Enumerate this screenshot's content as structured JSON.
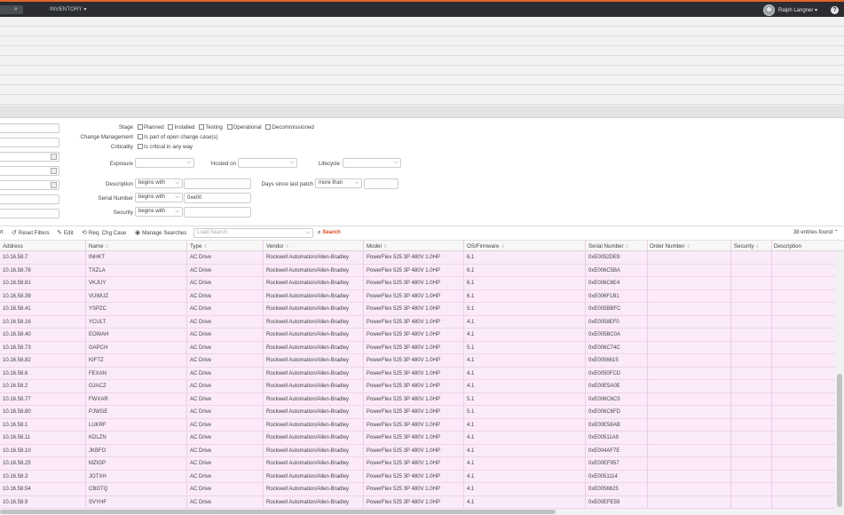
{
  "topbar": {
    "nav_inventory": "INVENTORY ▾",
    "user_name": "Ralph Langner ▾",
    "help": "?"
  },
  "filters": {
    "stage_label": "Stage",
    "stage_options": [
      "Planned",
      "Installed",
      "Testing",
      "Operational",
      "Decommissioned"
    ],
    "change_mgmt_label": "Change Management",
    "change_mgmt_option": "Is part of open change case(s)",
    "criticality_label": "Criticality",
    "criticality_option": "Is critical in any way",
    "exposure_label": "Exposure",
    "hosted_on_label": "Hosted on",
    "lifecycle_label": "Lifecycle",
    "description_label": "Description",
    "description_op": "begins with",
    "days_patch_label": "Days since last patch",
    "days_patch_op": "more than",
    "serial_label": "Serial Number",
    "serial_op": "begins with",
    "serial_value": "0xe00",
    "security_label": "Security",
    "security_op": "begins with"
  },
  "toolbar": {
    "export_label": "rt",
    "reset_filters": "Reset Filters",
    "edit": "Edit",
    "req_chg_case": "Req. Chg Case",
    "manage_searches": "Manage Searches",
    "load_search_placeholder": "Load Search",
    "search_button": "Search",
    "entries_found": "38 entries found"
  },
  "table": {
    "columns": [
      "Address",
      "Name",
      "Type",
      "Vendor",
      "Model",
      "OS/Firmware",
      "Serial Number",
      "Order Number",
      "Security",
      "Description"
    ],
    "rows": [
      [
        "10.16.58.7",
        "INHKT",
        "AC Drive",
        "Rockwell Automation/Allen-Bradley",
        "PowerFlex 525 3P 480V 1.0HP",
        "6.1",
        "0xE0052DE9"
      ],
      [
        "10.16.58.78",
        "TXZLA",
        "AC Drive",
        "Rockwell Automation/Allen-Bradley",
        "PowerFlex 525 3P 480V 1.0HP",
        "6.1",
        "0xE006C5BA"
      ],
      [
        "10.16.58.81",
        "VKJUY",
        "AC Drive",
        "Rockwell Automation/Allen-Bradley",
        "PowerFlex 525 3P 480V 1.0HP",
        "6.1",
        "0xE006C6E4"
      ],
      [
        "10.16.58.39",
        "VUWUZ",
        "AC Drive",
        "Rockwell Automation/Allen-Bradley",
        "PowerFlex 525 3P 480V 1.0HP",
        "6.1",
        "0xE006F1B1"
      ],
      [
        "10.16.58.41",
        "YSPZC",
        "AC Drive",
        "Rockwell Automation/Allen-Bradley",
        "PowerFlex 525 3P 480V 1.0HP",
        "5.1",
        "0xE005BBFC"
      ],
      [
        "10.16.58.16",
        "YCULT",
        "AC Drive",
        "Rockwell Automation/Allen-Bradley",
        "PowerFlex 525 3P 480V 1.0HP",
        "4.1",
        "0xE0058EF0"
      ],
      [
        "10.16.58.40",
        "EOWAH",
        "AC Drive",
        "Rockwell Automation/Allen-Bradley",
        "PowerFlex 525 3P 480V 1.0HP",
        "4.1",
        "0xE005BC0A"
      ],
      [
        "10.16.58.73",
        "GAPCH",
        "AC Drive",
        "Rockwell Automation/Allen-Bradley",
        "PowerFlex 525 3P 480V 1.0HP",
        "5.1",
        "0xE006C74C"
      ],
      [
        "10.16.58.82",
        "KIFTZ",
        "AC Drive",
        "Rockwell Automation/Allen-Bradley",
        "PowerFlex 525 3P 480V 1.0HP",
        "4.1",
        "0xE0056615"
      ],
      [
        "10.16.58.6",
        "FEXAN",
        "AC Drive",
        "Rockwell Automation/Allen-Bradley",
        "PowerFlex 525 3P 480V 1.0HP",
        "4.1",
        "0xE0050FCD"
      ],
      [
        "10.16.58.2",
        "OJACZ",
        "AC Drive",
        "Rockwell Automation/Allen-Bradley",
        "PowerFlex 525 3P 480V 1.0HP",
        "4.1",
        "0xE00E5A0E"
      ],
      [
        "10.16.58.77",
        "FWXAR",
        "AC Drive",
        "Rockwell Automation/Allen-Bradley",
        "PowerFlex 525 3P 480V 1.0HP",
        "5.1",
        "0xE006C6C5"
      ],
      [
        "10.16.58.80",
        "PJWGE",
        "AC Drive",
        "Rockwell Automation/Allen-Bradley",
        "PowerFlex 525 3P 480V 1.0HP",
        "5.1",
        "0xE006C6FD"
      ],
      [
        "10.16.58.1",
        "LUKRF",
        "AC Drive",
        "Rockwell Automation/Allen-Bradley",
        "PowerFlex 525 3P 480V 1.0HP",
        "4.1",
        "0xE00E58AB"
      ],
      [
        "10.16.58.11",
        "KDLZN",
        "AC Drive",
        "Rockwell Automation/Allen-Bradley",
        "PowerFlex 525 3P 480V 1.0HP",
        "4.1",
        "0xE00511A9"
      ],
      [
        "10.16.58.10",
        "JKBFO",
        "AC Drive",
        "Rockwell Automation/Allen-Bradley",
        "PowerFlex 525 3P 480V 1.0HP",
        "4.1",
        "0xE004AF7E"
      ],
      [
        "10.16.58.25",
        "MZIGP",
        "AC Drive",
        "Rockwell Automation/Allen-Bradley",
        "PowerFlex 525 3P 480V 1.0HP",
        "4.1",
        "0xE00EF957"
      ],
      [
        "10.16.58.3",
        "JOTXH",
        "AC Drive",
        "Rockwell Automation/Allen-Bradley",
        "PowerFlex 525 3P 480V 1.0HP",
        "4.1",
        "0xE0051114"
      ],
      [
        "10.16.58.54",
        "CBGTQ",
        "AC Drive",
        "Rockwell Automation/Allen-Bradley",
        "PowerFlex 525 3P 480V 1.0HP",
        "4.1",
        "0xE0056625"
      ],
      [
        "10.16.58.9",
        "SVYHF",
        "AC Drive",
        "Rockwell Automation/Allen-Bradley",
        "PowerFlex 525 3P 480V 1.0HP",
        "4.1",
        "0xE00EFE59"
      ]
    ]
  },
  "colors": {
    "accent": "#e0662b",
    "topbar_bg": "#2b2d31",
    "row_bg": "#fbeaf9",
    "search_button": "#d9451f"
  }
}
